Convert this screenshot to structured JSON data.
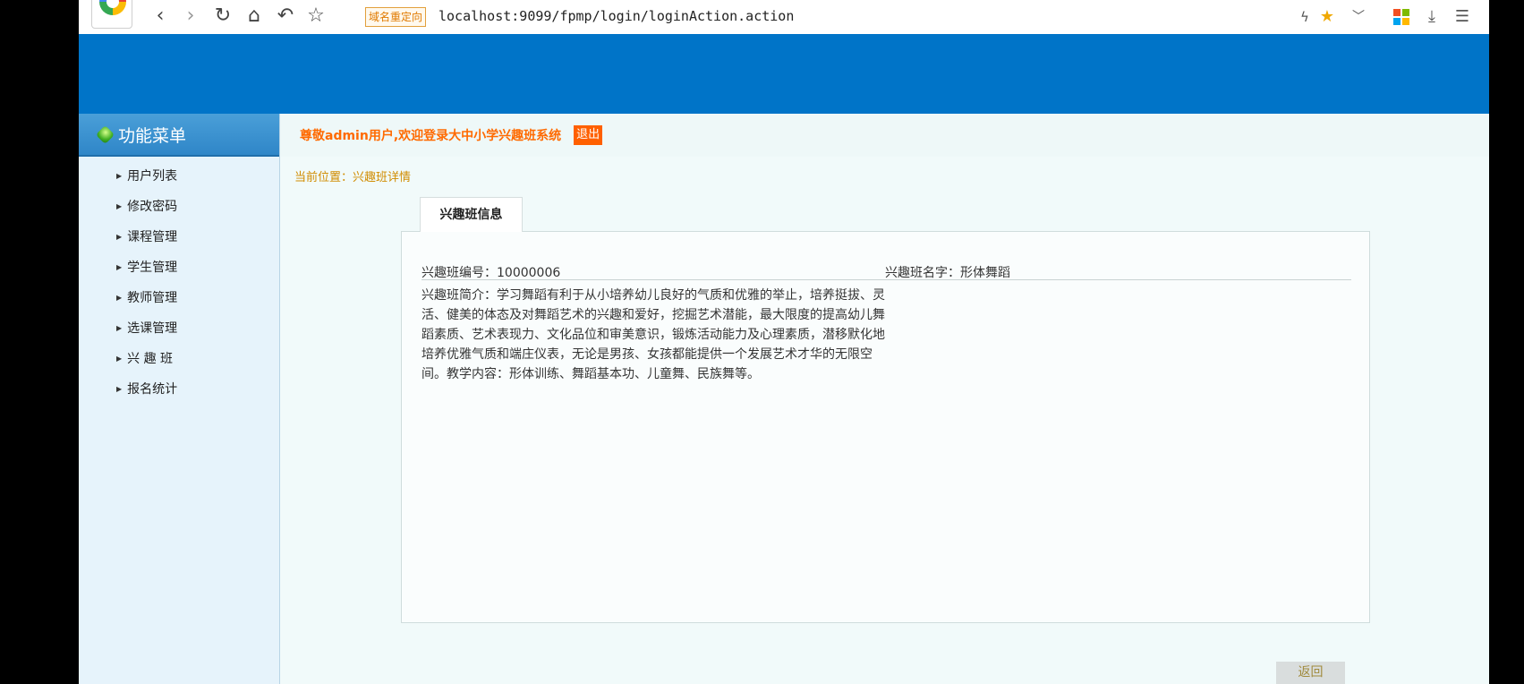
{
  "browser": {
    "redirect_label": "域名重定向",
    "url": "localhost:9099/fpmp/login/loginAction.action"
  },
  "sidebar": {
    "title": "功能菜单",
    "items": [
      {
        "label": "用户列表"
      },
      {
        "label": "修改密码"
      },
      {
        "label": "课程管理"
      },
      {
        "label": "学生管理"
      },
      {
        "label": "教师管理"
      },
      {
        "label": "选课管理"
      },
      {
        "label": "兴 趣 班"
      },
      {
        "label": "报名统计"
      }
    ]
  },
  "header": {
    "welcome": "尊敬admin用户,欢迎登录大中小学兴趣班系统",
    "logout_label": "退出"
  },
  "breadcrumb": "当前位置：兴趣班详情",
  "tab_label": "兴趣班信息",
  "detail": {
    "id_text": "兴趣班编号：10000006",
    "name_text": "兴趣班名字：形体舞蹈",
    "intro_text": "兴趣班简介：学习舞蹈有利于从小培养幼儿良好的气质和优雅的举止，培养挺拔、灵活、健美的体态及对舞蹈艺术的兴趣和爱好，挖掘艺术潜能，最大限度的提高幼儿舞蹈素质、艺术表现力、文化品位和审美意识，锻炼活动能力及心理素质，潜移默化地培养优雅气质和端庄仪表，无论是男孩、女孩都能提供一个发展艺术才华的无限空间。教学内容：形体训练、舞蹈基本功、儿童舞、民族舞等。"
  },
  "back_label": "返回",
  "colors": {
    "banner": "#0074c8",
    "welcome": "#ff6a00",
    "logout_bg": "#ff6000",
    "breadcrumb": "#d18c00"
  },
  "icons": [
    "back-icon",
    "forward-icon",
    "reload-icon",
    "home-icon",
    "undo-icon",
    "star-icon",
    "lightning-icon",
    "favorite-star-icon",
    "chevron-down-icon",
    "apps-icon",
    "download-icon",
    "menu-icon"
  ]
}
